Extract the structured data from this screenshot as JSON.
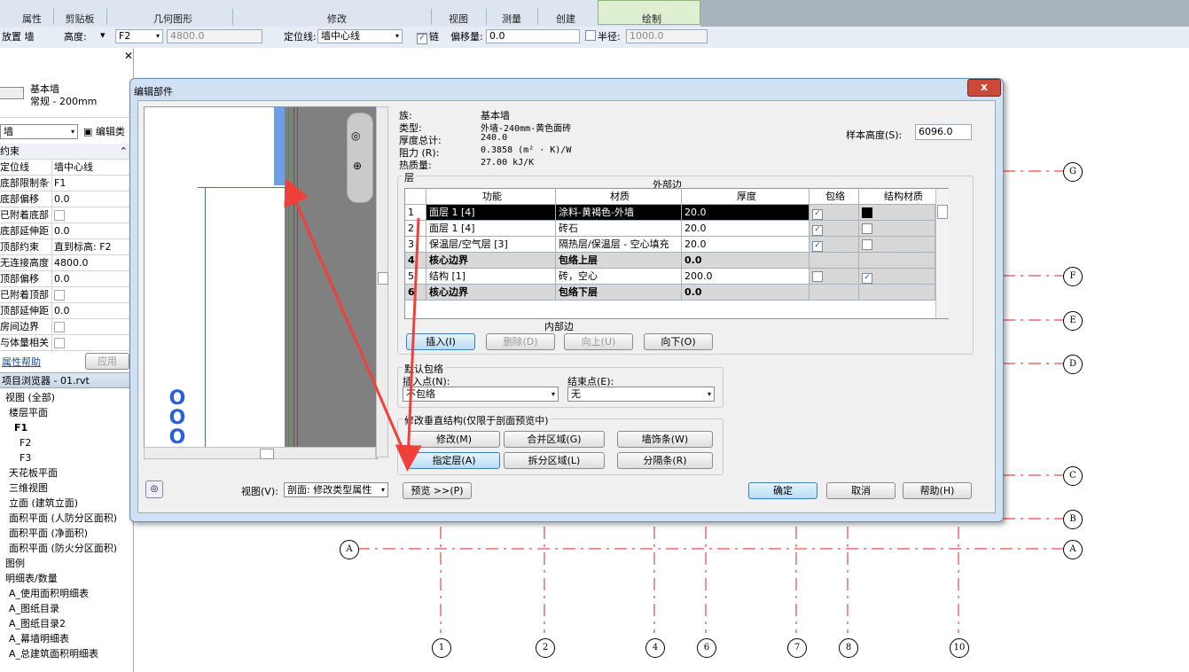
{
  "ribbon": {
    "groups": [
      "属性",
      "剪贴板",
      "几何图形",
      "修改",
      "视图",
      "测量",
      "创建",
      "绘制"
    ]
  },
  "options_bar": {
    "place_label": "放置 墙",
    "height_label": "高度:",
    "height_value": "F2",
    "height_number": "4800.0",
    "locline_label": "定位线:",
    "locline_value": "墙中心线",
    "chain_label": "链",
    "offset_label": "偏移量:",
    "offset_value": "0.0",
    "radius_label": "半径:",
    "radius_value": "1000.0"
  },
  "properties": {
    "family_name": "基本墙",
    "type_name": "常规 - 200mm",
    "type_selector": "墙",
    "edit_type": "编辑类",
    "section": "约束",
    "rows": [
      {
        "k": "定位线",
        "v": "墙中心线"
      },
      {
        "k": "底部限制条件",
        "v": "F1"
      },
      {
        "k": "底部偏移",
        "v": "0.0"
      },
      {
        "k": "已附着底部",
        "v": ""
      },
      {
        "k": "底部延伸距离",
        "v": "0.0"
      },
      {
        "k": "顶部约束",
        "v": "直到标高: F2"
      },
      {
        "k": "无连接高度",
        "v": "4800.0"
      },
      {
        "k": "顶部偏移",
        "v": "0.0"
      },
      {
        "k": "已附着顶部",
        "v": ""
      },
      {
        "k": "顶部延伸距离",
        "v": "0.0"
      },
      {
        "k": "房间边界",
        "v": ""
      },
      {
        "k": "与体量相关",
        "v": ""
      }
    ],
    "help_link": "属性帮助",
    "apply": "应用"
  },
  "browser": {
    "title": "项目浏览器 - 01.rvt",
    "items": [
      "视图 (全部)",
      "楼层平面",
      "F1",
      "F2",
      "F3",
      "天花板平面",
      "三维视图",
      "立面 (建筑立面)",
      "面积平面 (人防分区面积)",
      "面积平面 (净面积)",
      "面积平面 (防火分区面积)",
      "图例",
      "明细表/数量",
      "A_使用面积明细表",
      "A_图纸目录",
      "A_图纸目录2",
      "A_幕墙明细表",
      "A_总建筑面积明细表"
    ]
  },
  "grid": {
    "rows": [
      "G",
      "F",
      "E",
      "D",
      "C",
      "B",
      "A"
    ],
    "cols": [
      "1",
      "2",
      "4",
      "6",
      "7",
      "8",
      "10"
    ]
  },
  "dialog": {
    "title": "编辑部件",
    "family_label": "族:",
    "family_value": "基本墙",
    "type_label": "类型:",
    "type_value": "外墙-240mm-黄色面砖",
    "thickness_label": "厚度总计:",
    "thickness_value": "240.0",
    "resistance_label": "阻力 (R):",
    "resistance_value": "0.3858 (m² · K)/W",
    "thermal_label": "热质量:",
    "thermal_value": "27.00 kJ/K",
    "sample_height_label": "样本高度(S):",
    "sample_height_value": "6096.0",
    "layers_group": "层",
    "exterior_side": "外部边",
    "interior_side": "内部边",
    "columns": [
      "",
      "功能",
      "材质",
      "厚度",
      "包络",
      "结构材质"
    ],
    "layers": [
      {
        "n": "1",
        "func": "面层 1 [4]",
        "mat": "涂料-黄褐色-外墙",
        "thk": "20.0",
        "wrap": "✓",
        "struct": ""
      },
      {
        "n": "2",
        "func": "面层 1 [4]",
        "mat": "砖石",
        "thk": "20.0",
        "wrap": "✓",
        "struct": ""
      },
      {
        "n": "3",
        "func": "保温层/空气层 [3]",
        "mat": "隔热层/保温层 - 空心填充",
        "thk": "20.0",
        "wrap": "✓",
        "struct": ""
      },
      {
        "n": "4",
        "func": "核心边界",
        "mat": "包络上层",
        "thk": "0.0",
        "wrap": "",
        "struct": ""
      },
      {
        "n": "5",
        "func": "结构 [1]",
        "mat": "砖，空心",
        "thk": "200.0",
        "wrap": "",
        "struct": "✓"
      },
      {
        "n": "6",
        "func": "核心边界",
        "mat": "包络下层",
        "thk": "0.0",
        "wrap": "",
        "struct": ""
      }
    ],
    "btn_insert": "插入(I)",
    "btn_delete": "删除(D)",
    "btn_up": "向上(U)",
    "btn_down": "向下(O)",
    "default_wrap_group": "默认包络",
    "insert_point_label": "插入点(N):",
    "insert_point_value": "不包络",
    "end_point_label": "结束点(E):",
    "end_point_value": "无",
    "vertical_group": "修改垂直结构(仅限于剖面预览中)",
    "btn_modify": "修改(M)",
    "btn_merge": "合并区域(G)",
    "btn_sweeps": "墙饰条(W)",
    "btn_assign": "指定层(A)",
    "btn_split": "拆分区域(L)",
    "btn_reveals": "分隔条(R)",
    "view_label": "视图(V):",
    "view_value": "剖面: 修改类型属性",
    "btn_preview": "预览 >>(P)",
    "btn_ok": "确定",
    "btn_cancel": "取消",
    "btn_help": "帮助(H)",
    "close_glyph": "x"
  },
  "colors": {
    "arrow": "#f0403a",
    "grid_line": "#e02020",
    "selected_row": "#000000",
    "accent": "#3c7fb1"
  }
}
